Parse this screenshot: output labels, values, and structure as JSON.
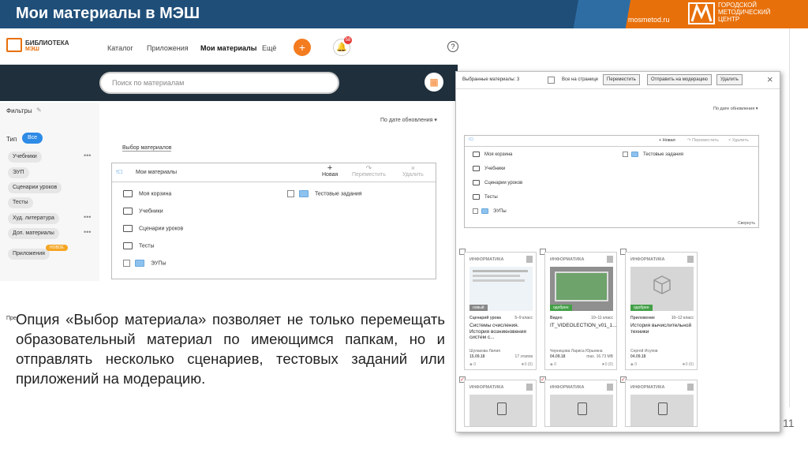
{
  "header": {
    "title": "Мои материалы в МЭШ",
    "site": "mosmetod.ru",
    "org": "ГОРОДСКОЙ МЕТОДИЧЕСКИЙ ЦЕНТР",
    "colors": {
      "bar": "#1f4e79",
      "accent": "#e8700a"
    }
  },
  "app": {
    "logo_line1": "БИБЛИОТЕКА",
    "logo_line2": "МЭШ",
    "nav": [
      "Каталог",
      "Приложения",
      "Мои материалы",
      "Ещё"
    ],
    "plus_icon": "+",
    "help_icon": "?",
    "bell_count": "58",
    "search_placeholder": "Поиск по материалам"
  },
  "sidebar": {
    "title": "Фильтры",
    "type_label": "Тип",
    "all_chip": "Все",
    "chips": [
      "Учебники",
      "ЭУП",
      "Сценарии уроков",
      "Тесты",
      "Худ. литература",
      "Доп. материалы",
      "Приложения"
    ],
    "new_badge": "НОВОЕ",
    "footer": "Пре"
  },
  "main": {
    "sort": "По дате обновления ▾",
    "pick_label": "Выбор материалов",
    "folder_root": "Мои материалы",
    "actions": [
      "Новая",
      "Переместить",
      "Удалить"
    ],
    "folders_left": [
      "Моя корзина",
      "Учебники",
      "Сценарии уроков",
      "Тесты",
      "ЭУПы"
    ],
    "folders_right": [
      "Тестовые задания"
    ]
  },
  "overlay": {
    "selected": "Выбранные материалы: 3",
    "all_on_page": "Все на странице",
    "buttons": [
      "Переместить",
      "Отправить на модерацию",
      "Удалить"
    ],
    "close_icon": "×",
    "sort": "По дате обновления ▾",
    "folder_actions": [
      "Новая",
      "Переместить",
      "Удалить"
    ],
    "folders_left": [
      "Моя корзина",
      "Учебники",
      "Сценарии уроков",
      "Тесты",
      "ЭУПы"
    ],
    "folders_right": [
      "Тестовые задания"
    ],
    "collapse": "Свернуть",
    "cards": [
      {
        "subject": "ИНФОРМАТИКА",
        "tag": "новый",
        "type": "Сценарий урока",
        "grade": "5–9 класс",
        "title": "Системы счисления. История возникновения систем с...",
        "author": "Шулакова Лилия",
        "date": "15.09.18",
        "count": "17 этапов",
        "rating": "★0 (0)",
        "checked": false
      },
      {
        "subject": "ИНФОРМАТИКА",
        "tag": "одобрен",
        "type": "Видео",
        "grade": "10–11 класс",
        "title": "IT_VIDEOLECTION_v01_1...",
        "author": "Чернецова Лариса Юрьевна",
        "date": "04.09.18",
        "count": "max. 16.73 MB",
        "rating": "★0 (0)",
        "checked": false
      },
      {
        "subject": "ИНФОРМАТИКА",
        "tag": "одобрен",
        "type": "Приложение",
        "grade": "10–12 класс",
        "title": "История вычислительной техники",
        "author": "Сергей Исупов",
        "date": "04.09.18",
        "count": "",
        "rating": "★0 (0)",
        "checked": false
      },
      {
        "subject": "ИНФОРМАТИКА",
        "checked": true
      },
      {
        "subject": "ИНФОРМАТИКА",
        "checked": true
      },
      {
        "subject": "ИНФОРМАТИКА",
        "checked": true
      }
    ]
  },
  "description": "Опция «Выбор материала» позволяет не только перемещать образовательный материал по имеющимся папкам, но и отправлять несколько сценариев, тестовых заданий или приложений на модерацию.",
  "page_number": "11"
}
